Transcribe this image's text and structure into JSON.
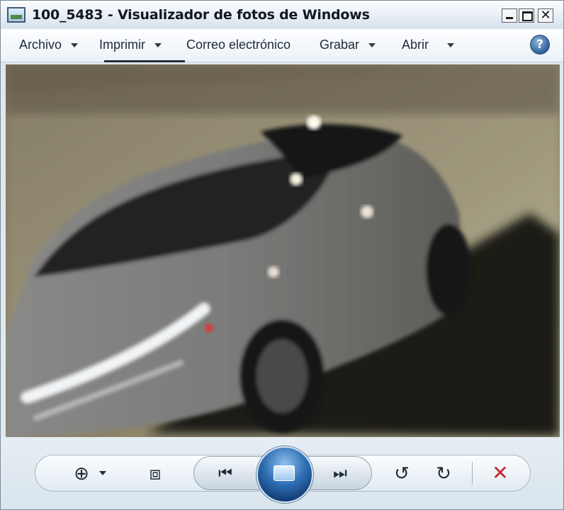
{
  "window": {
    "title": "100_5483 - Visualizador de fotos de Windows",
    "close_glyph": "✕"
  },
  "menubar": {
    "items": [
      {
        "label": "Archivo",
        "has_dropdown": true
      },
      {
        "label": "Imprimir",
        "has_dropdown": true
      },
      {
        "label": "Correo electrónico",
        "has_dropdown": false
      },
      {
        "label": "Grabar",
        "has_dropdown": true
      },
      {
        "label": "Abrir",
        "has_dropdown": true
      }
    ],
    "help_glyph": "?"
  },
  "photo": {
    "subject": "blurred silver car in a parking garage",
    "colors": {
      "wall": "#6f6857",
      "floor": "#a39c80",
      "car": "#7f7d7a",
      "shadow": "#1f1d16"
    }
  },
  "toolbar": {
    "icons": {
      "zoom": "zoom-icon",
      "fit": "actual-size-icon",
      "previous": "previous-icon",
      "slideshow": "slideshow-icon",
      "next": "next-icon",
      "rotate_left": "rotate-counterclockwise-icon",
      "rotate_right": "rotate-clockwise-icon",
      "delete": "delete-icon"
    },
    "glyphs": {
      "zoom": "⊕",
      "fit": "⧈",
      "previous": "⏮",
      "next": "⏭",
      "rotate_left": "↺",
      "rotate_right": "↻",
      "delete": "✕"
    },
    "accent_color": "#2f6fb4",
    "delete_color": "#c0262b"
  }
}
